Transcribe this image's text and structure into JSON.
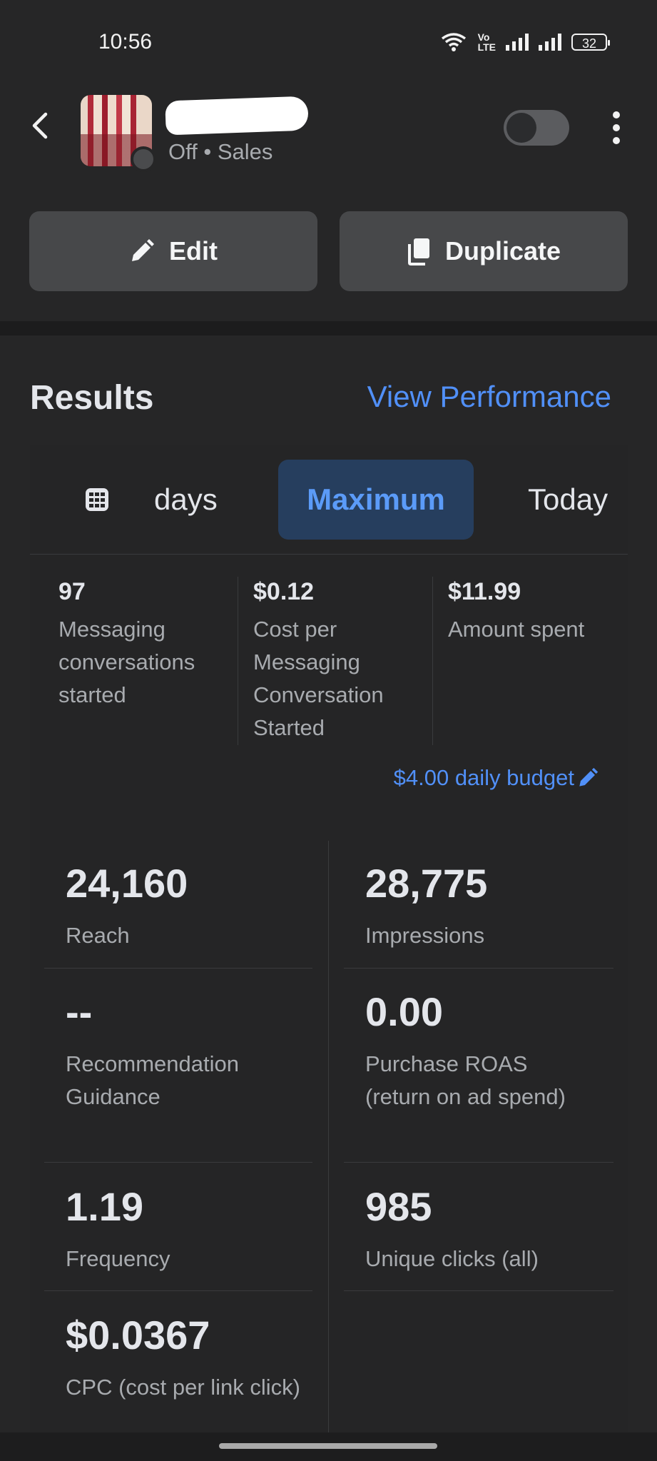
{
  "status_bar": {
    "time": "10:56",
    "network_label": "Vo\nLTE",
    "battery": "32"
  },
  "header": {
    "subtitle": "Off • Sales",
    "toggle_state": "off",
    "edit_label": "Edit",
    "duplicate_label": "Duplicate"
  },
  "results": {
    "title": "Results",
    "view_performance": "View Performance",
    "tabs": {
      "days": "days",
      "maximum": "Maximum",
      "today": "Today"
    },
    "summary": [
      {
        "value": "97",
        "label": "Messaging conversations started"
      },
      {
        "value": "$0.12",
        "label": "Cost per Messaging Conversation Started"
      },
      {
        "value": "$11.99",
        "label": "Amount spent"
      }
    ],
    "budget": "$4.00 daily budget",
    "metrics": [
      {
        "value": "24,160",
        "label": "Reach"
      },
      {
        "value": "28,775",
        "label": "Impressions"
      },
      {
        "value": "--",
        "label": "Recommendation Guidance"
      },
      {
        "value": "0.00",
        "label": "Purchase ROAS (return on ad spend)"
      },
      {
        "value": "1.19",
        "label": "Frequency"
      },
      {
        "value": "985",
        "label": "Unique clicks (all)"
      },
      {
        "value": "$0.0367",
        "label": "CPC (cost per link click)"
      }
    ]
  },
  "colors": {
    "background": "#262627",
    "accent_link": "#5190f8",
    "selected_tab_bg": "#263e5e",
    "button_bg": "#47484a"
  },
  "icons": [
    "chevron-left-icon",
    "more-vertical-icon",
    "pencil-icon",
    "copy-icon",
    "calendar-icon",
    "pencil-small-icon",
    "wifi-icon",
    "signal-icon",
    "battery-icon"
  ]
}
